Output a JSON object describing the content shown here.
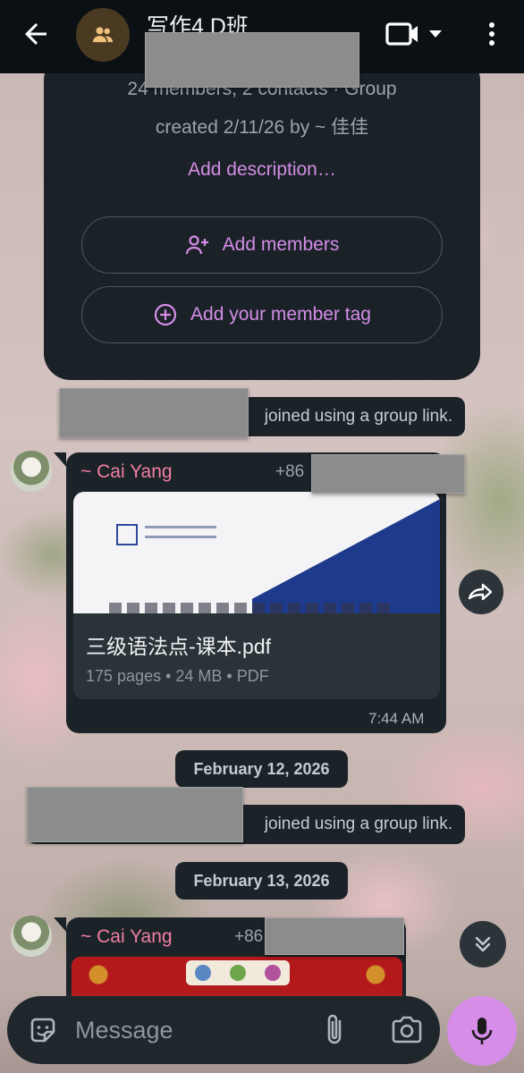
{
  "header": {
    "title": "写作4 D班",
    "back_icon": "arrow-left-icon",
    "avatar_icon": "group-icon",
    "video_icon": "video-camera-icon",
    "more_icon": "more-vertical-icon"
  },
  "group_info": {
    "members_line": "24 members, 2 contacts · Group",
    "created_line": "created 2/11/26 by ~ 佳佳",
    "add_description": "Add description…",
    "add_members_label": "Add members",
    "add_member_tag_label": "Add your member tag"
  },
  "messages": {
    "join_1": "joined using a group link.",
    "msg_1": {
      "sender": "~ Cai Yang",
      "phone_prefix": "+86",
      "doc_name": "三级语法点-课本.pdf",
      "doc_meta": "175 pages • 24 MB • PDF",
      "time": "7:44 AM"
    },
    "date_1": "February 12, 2026",
    "join_2": "joined using a group link.",
    "date_2": "February 13, 2026",
    "msg_2": {
      "sender": "~ Cai Yang",
      "phone_prefix": "+86"
    }
  },
  "composer": {
    "placeholder": "Message",
    "emoji_icon": "sticker-icon",
    "attach_icon": "paperclip-icon",
    "camera_icon": "camera-icon",
    "mic_icon": "microphone-icon"
  },
  "colors": {
    "accent": "#d58de8",
    "sender_name": "#f27ea4",
    "bubble": "#1b2328",
    "topbar": "#0b1014"
  }
}
